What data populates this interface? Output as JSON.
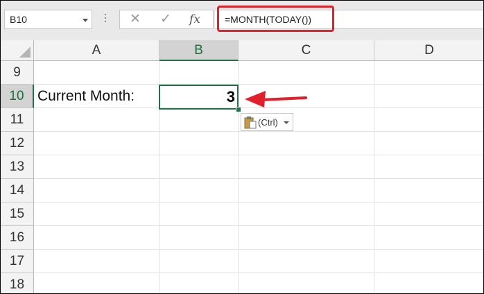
{
  "formula_bar": {
    "name_box": "B10",
    "formula": "=MONTH(TODAY())",
    "cancel_icon": "close-icon",
    "enter_icon": "check-icon",
    "function_label": "fx"
  },
  "columns": [
    "A",
    "B",
    "C",
    "D"
  ],
  "selected_column": "B",
  "rows": [
    "9",
    "10",
    "11",
    "12",
    "13",
    "14",
    "15",
    "16",
    "17",
    "18"
  ],
  "selected_row": "10",
  "cells": {
    "A10": "Current Month:",
    "B10": "3"
  },
  "paste_options": {
    "label": "(Ctrl)"
  },
  "annotations": {
    "highlight_color": "#e1202b",
    "accent_color": "#217346"
  }
}
